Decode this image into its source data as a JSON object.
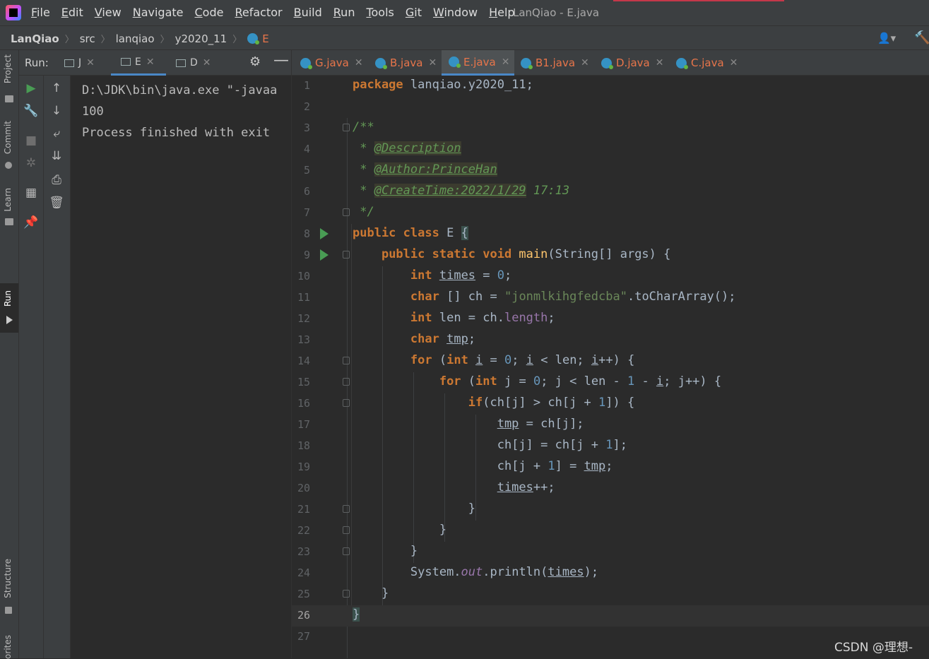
{
  "window": {
    "title": "LanQiao - E.java"
  },
  "menu": [
    "File",
    "Edit",
    "View",
    "Navigate",
    "Code",
    "Refactor",
    "Build",
    "Run",
    "Tools",
    "Git",
    "Window",
    "Help"
  ],
  "breadcrumb": [
    "LanQiao",
    "src",
    "lanqiao",
    "y2020_11",
    "E"
  ],
  "left_stripe": {
    "project": "Project",
    "commit": "Commit",
    "learn": "Learn",
    "run": "Run",
    "structure": "Structure",
    "favorites": "orites"
  },
  "run_panel": {
    "label": "Run:",
    "tabs": [
      "J",
      "E",
      "D"
    ],
    "active_tab": "E",
    "console": [
      "D:\\JDK\\bin\\java.exe \"-javaa",
      "100",
      "",
      "Process finished with exit"
    ]
  },
  "editor": {
    "tabs": [
      "G.java",
      "B.java",
      "E.java",
      "B1.java",
      "D.java",
      "C.java"
    ],
    "active_tab": "E.java",
    "line_numbers": [
      "1",
      "2",
      "3",
      "4",
      "5",
      "6",
      "7",
      "8",
      "9",
      "10",
      "11",
      "12",
      "13",
      "14",
      "15",
      "16",
      "17",
      "18",
      "19",
      "20",
      "21",
      "22",
      "23",
      "24",
      "25",
      "26",
      "27"
    ],
    "current_line": "26",
    "code": {
      "l1_kw": "package",
      "l1_pkg": " lanqiao.y2020_11;",
      "l3": "/**",
      "l4_star": " * ",
      "l4_tag": "@Description",
      "l5_star": " * ",
      "l5_tag": "@Author:PrinceHan",
      "l6_star": " * ",
      "l6_tag": "@CreateTime:2022/1/29",
      "l6_rest": " 17:13",
      "l7": " */",
      "l8_kw": "public class",
      "l8_name": " E ",
      "l8_brace": "{",
      "l9_kw": "public static void",
      "l9_m": " main",
      "l9_rest": "(String[] args) {",
      "l10_kw": "int",
      "l10_v": "times",
      "l10_eq": " = ",
      "l10_n": "0",
      "l10_end": ";",
      "l11_kw": "char",
      "l11_a": " [] ch = ",
      "l11_s": "\"jonmlkihgfedcba\"",
      "l11_m": ".toCharArray",
      "l11_end": "();",
      "l12_kw": "int",
      "l12_a": " len = ch.",
      "l12_f": "length",
      "l12_end": ";",
      "l13_kw": "char",
      "l13_v": "tmp",
      "l13_end": ";",
      "l14_kw": "for",
      "l14_p": " (",
      "l14_kw2": "int",
      "l14_i": "i",
      "l14_eq": " = ",
      "l14_n": "0",
      "l14_sc": "; ",
      "l14_i2": "i",
      "l14_lt": " < len; ",
      "l14_i3": "i",
      "l14_end": "++) {",
      "l15_kw": "for",
      "l15_p": " (",
      "l15_kw2": "int",
      "l15_a": " j = ",
      "l15_n": "0",
      "l15_b": "; j < len - ",
      "l15_n2": "1",
      "l15_c": " - ",
      "l15_i": "i",
      "l15_end": "; j++) {",
      "l16_kw": "if",
      "l16_a": "(ch[j] > ch[j + ",
      "l16_n": "1",
      "l16_end": "]) {",
      "l17_v": "tmp",
      "l17_end": " = ch[j];",
      "l18_a": "ch[j] = ch[j + ",
      "l18_n": "1",
      "l18_end": "];",
      "l19_a": "ch[j + ",
      "l19_n": "1",
      "l19_b": "] = ",
      "l19_v": "tmp",
      "l19_end": ";",
      "l20_v": "times",
      "l20_end": "++;",
      "l21": "}",
      "l22": "}",
      "l23": "}",
      "l24_a": "System.",
      "l24_f": "out",
      "l24_m": ".println",
      "l24_p": "(",
      "l24_v": "times",
      "l24_end": ");",
      "l25": "}",
      "l26": "}"
    }
  },
  "watermark": "CSDN @理想-",
  "colors": {
    "keyword": "#cc7832",
    "number": "#6897bb",
    "string": "#6a8759",
    "comment": "#629755",
    "field": "#9876aa",
    "text": "#a9b7c6",
    "accent": "#4a88c7"
  }
}
